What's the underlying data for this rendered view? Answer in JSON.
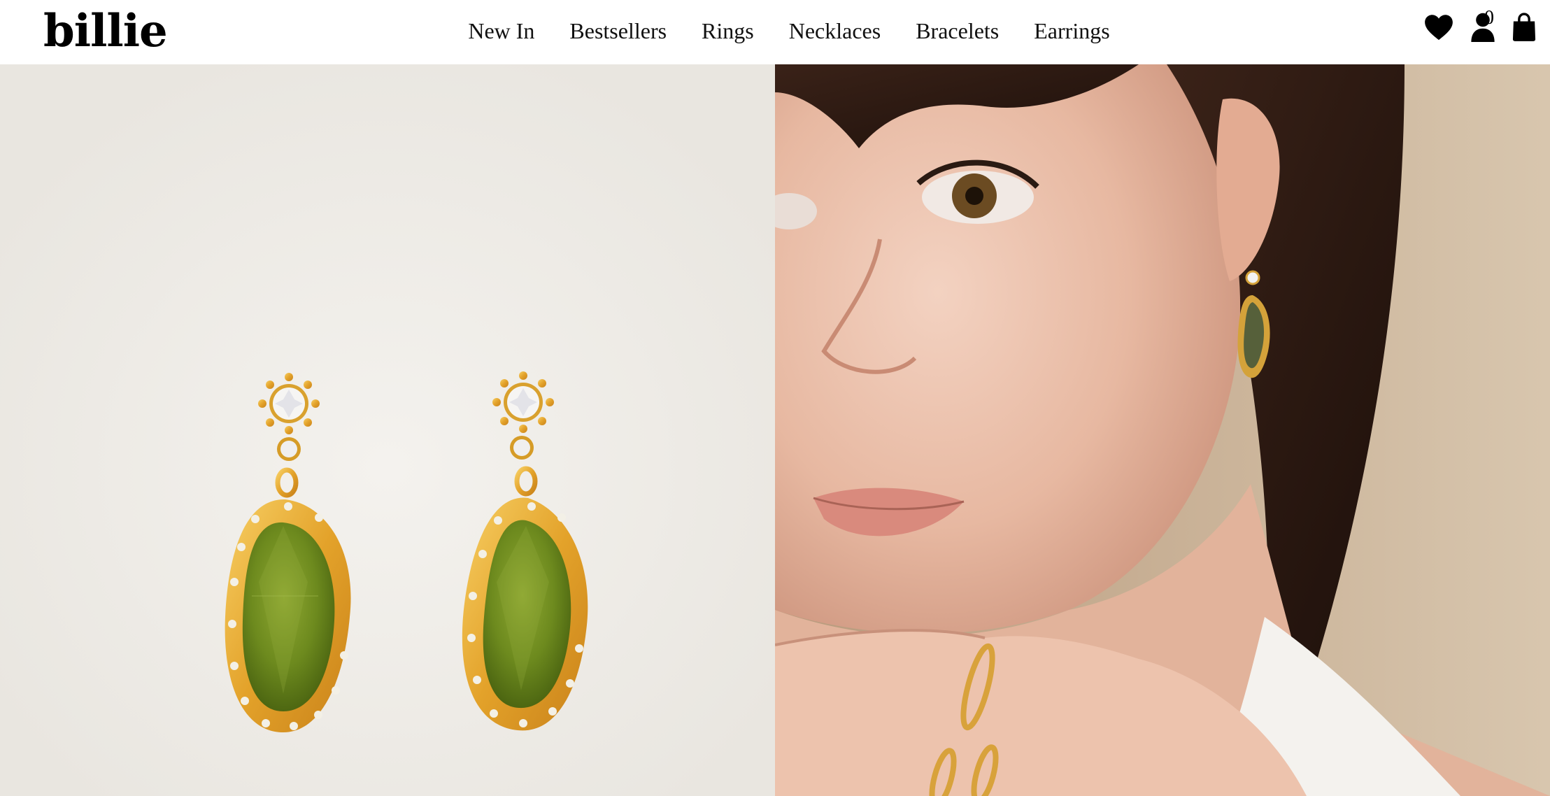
{
  "brand": {
    "logo": "billie"
  },
  "nav": {
    "items": [
      "New In",
      "Bestsellers",
      "Rings",
      "Necklaces",
      "Bracelets",
      "Earrings"
    ]
  },
  "header_icons": {
    "wishlist": "heart-icon",
    "account": "user-icon",
    "cart": "bag-icon",
    "cart_count": "0"
  },
  "colors": {
    "background": "#ffffff",
    "text": "#000000",
    "product_backdrop": "#edebe6",
    "gold": "#e0a52b",
    "peridot": "#6f8a1f"
  }
}
